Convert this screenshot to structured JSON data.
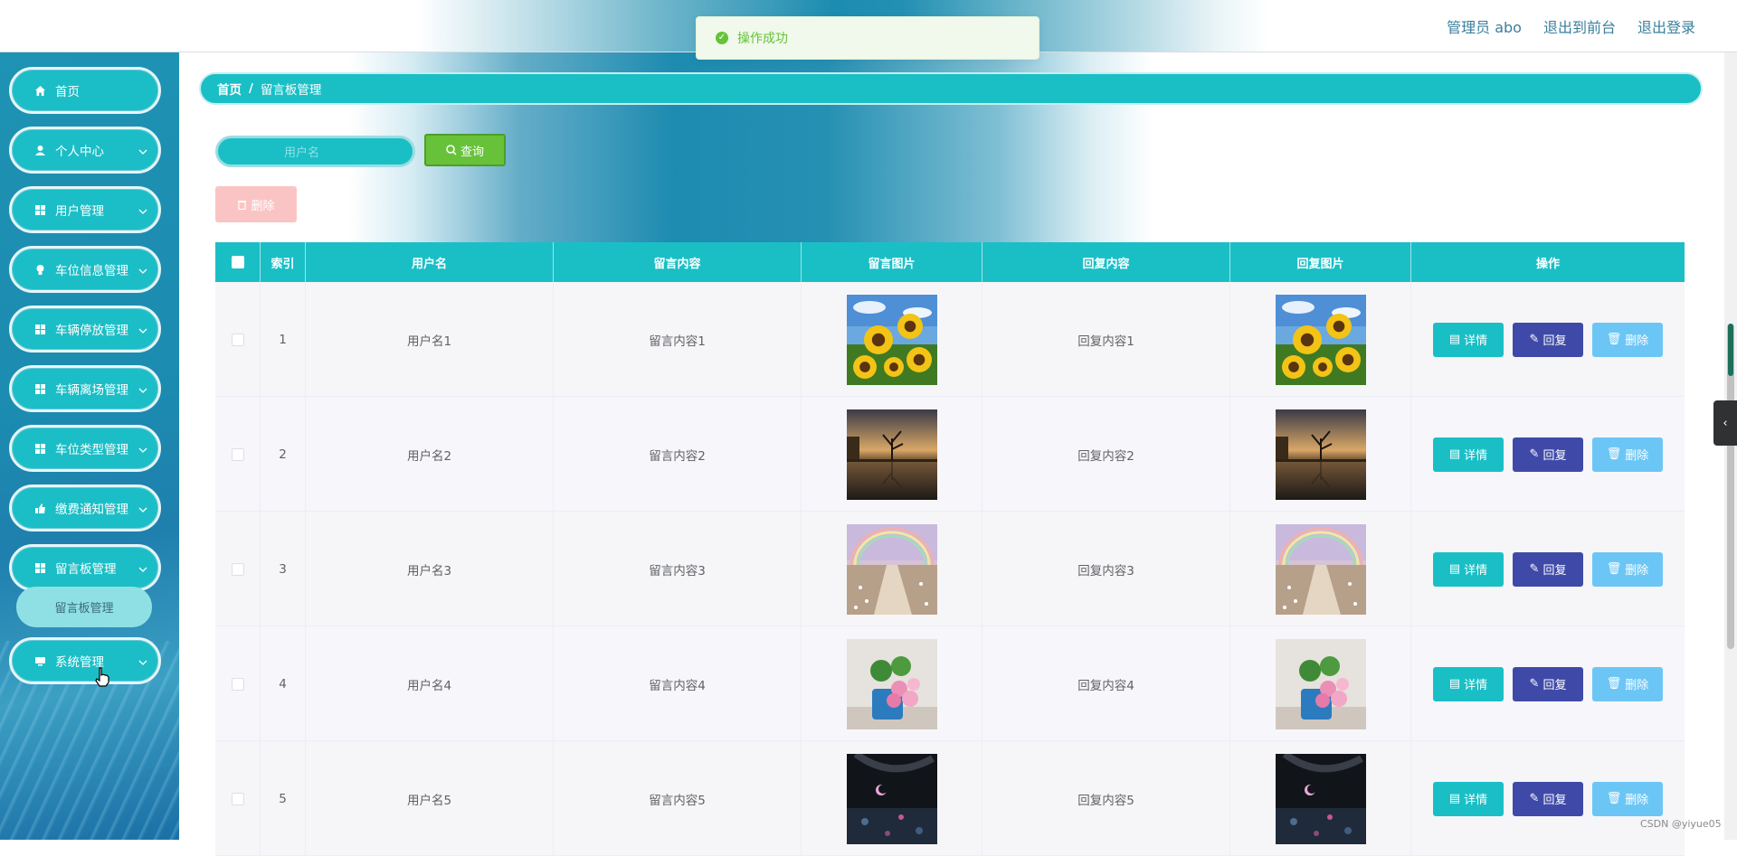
{
  "header": {
    "admin_label": "管理员 abo",
    "front_link": "退出到前台",
    "logout_link": "退出登录"
  },
  "toast": {
    "message": "操作成功"
  },
  "sidebar": {
    "items": [
      {
        "label": "首页",
        "icon": "home-icon",
        "has_children": false
      },
      {
        "label": "个人中心",
        "icon": "user-icon",
        "has_children": true
      },
      {
        "label": "用户管理",
        "icon": "grid-icon",
        "has_children": true
      },
      {
        "label": "车位信息管理",
        "icon": "bulb-icon",
        "has_children": true
      },
      {
        "label": "车辆停放管理",
        "icon": "grid-icon",
        "has_children": true
      },
      {
        "label": "车辆离场管理",
        "icon": "grid-icon",
        "has_children": true
      },
      {
        "label": "车位类型管理",
        "icon": "grid-icon",
        "has_children": true
      },
      {
        "label": "缴费通知管理",
        "icon": "thumb-icon",
        "has_children": true
      },
      {
        "label": "留言板管理",
        "icon": "grid-icon",
        "has_children": true
      },
      {
        "label": "系统管理",
        "icon": "monitor-icon",
        "has_children": true
      }
    ],
    "submenu": {
      "label": "留言板管理"
    }
  },
  "breadcrumb": {
    "home": "首页",
    "separator": "/",
    "current": "留言板管理"
  },
  "search": {
    "placeholder": "用户名",
    "button_label": "查询"
  },
  "batch_delete_label": "删除",
  "table": {
    "columns": [
      "索引",
      "用户名",
      "留言内容",
      "留言图片",
      "回复内容",
      "回复图片",
      "操作"
    ],
    "rows": [
      {
        "index": "1",
        "username": "用户名1",
        "message": "留言内容1",
        "reply": "回复内容1",
        "image": "sunflowers"
      },
      {
        "index": "2",
        "username": "用户名2",
        "message": "留言内容2",
        "reply": "回复内容2",
        "image": "lake-tree"
      },
      {
        "index": "3",
        "username": "用户名3",
        "message": "留言内容3",
        "reply": "回复内容3",
        "image": "rainbow-path"
      },
      {
        "index": "4",
        "username": "用户名4",
        "message": "留言内容4",
        "reply": "回复内容4",
        "image": "flower-pot"
      },
      {
        "index": "5",
        "username": "用户名5",
        "message": "留言内容5",
        "reply": "回复内容5",
        "image": "night-umbrella"
      }
    ],
    "actions": {
      "detail": "详情",
      "reply": "回复",
      "delete": "删除"
    }
  },
  "watermark": "CSDN @yiyue05",
  "colors": {
    "accent": "#1abfc6",
    "reply": "#3f4aa8",
    "delete": "#6cc6f5",
    "success": "#67c23a"
  }
}
